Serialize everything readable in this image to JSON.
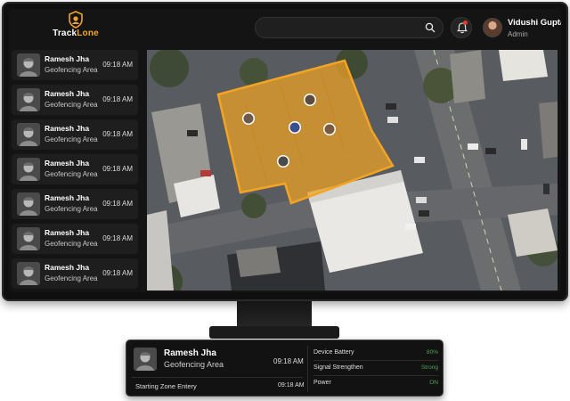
{
  "app": {
    "logo_part1": "Track",
    "logo_part2": "Lone"
  },
  "search": {
    "placeholder": ""
  },
  "user": {
    "name": "Vidushi Gupta",
    "role": "Admin"
  },
  "alerts": [
    {
      "name": "Ramesh Jha",
      "area": "Geofencing Area",
      "time": "09:18 AM"
    },
    {
      "name": "Ramesh Jha",
      "area": "Geofencing Area",
      "time": "09:18 AM"
    },
    {
      "name": "Ramesh Jha",
      "area": "Geofencing Area",
      "time": "09:18 AM"
    },
    {
      "name": "Ramesh Jha",
      "area": "Geofencing Area",
      "time": "09:18 AM"
    },
    {
      "name": "Ramesh Jha",
      "area": "Geofencing Area",
      "time": "09:18 AM"
    },
    {
      "name": "Ramesh Jha",
      "area": "Geofencing Area",
      "time": "09:18 AM"
    },
    {
      "name": "Ramesh Jha",
      "area": "Geofencing Area",
      "time": "09:18 AM"
    }
  ],
  "detail": {
    "name": "Ramesh Jha",
    "area": "Geofencing Area",
    "time": "09:18 AM",
    "event": "Starting Zone Entery",
    "event_time": "09:18 AM",
    "stats": [
      {
        "label": "Device Battery",
        "value": "80%"
      },
      {
        "label": "Signal Strengthen",
        "value": "Strong"
      },
      {
        "label": "Power",
        "value": "ON"
      }
    ]
  },
  "colors": {
    "accent": "#f3a424",
    "status_green": "#4ca552",
    "alert_red": "#e23b2e"
  },
  "icons": [
    "shield-logo-icon",
    "search-icon",
    "bell-icon",
    "map-user-pin-icon"
  ]
}
